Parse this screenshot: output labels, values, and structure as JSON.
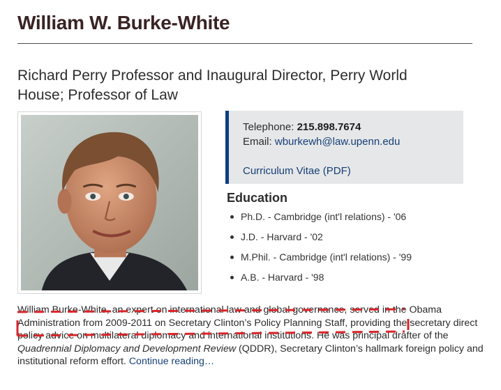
{
  "profile": {
    "name": "William W. Burke-White",
    "title": "Richard Perry Professor and Inaugural Director, Perry World House; Professor of Law"
  },
  "contact": {
    "telephone_label": "Telephone:",
    "telephone": "215.898.7674",
    "email_label": "Email:",
    "email": "wburkewh@law.upenn.edu",
    "cv_link": "Curriculum Vitae (PDF)"
  },
  "education": {
    "heading": "Education",
    "items": [
      "Ph.D. - Cambridge (int'l relations) - '06",
      "J.D. - Harvard - '02",
      "M.Phil. - Cambridge (int'l relations) - '99",
      "A.B. - Harvard - '98"
    ]
  },
  "bio": {
    "text_1": "William Burke-White, an expert on international law and global governance, served in the Obama Administration from 2009-2011 on Secretary Clinton’s Policy Planning Staff, providing the secretary direct policy advice on multilateral diplomacy and international institutions. He was principal drafter of the ",
    "report_title": "Quadrennial Diplomacy and Development Review",
    "text_2": " (QDDR), Secretary Clinton’s hallmark foreign policy and institutional reform effort. ",
    "continue_link": "Continue reading…"
  },
  "colors": {
    "accent_bar": "#0c3e86",
    "link": "#163f78",
    "name": "#3a2323",
    "annotation": "#d8262b"
  }
}
